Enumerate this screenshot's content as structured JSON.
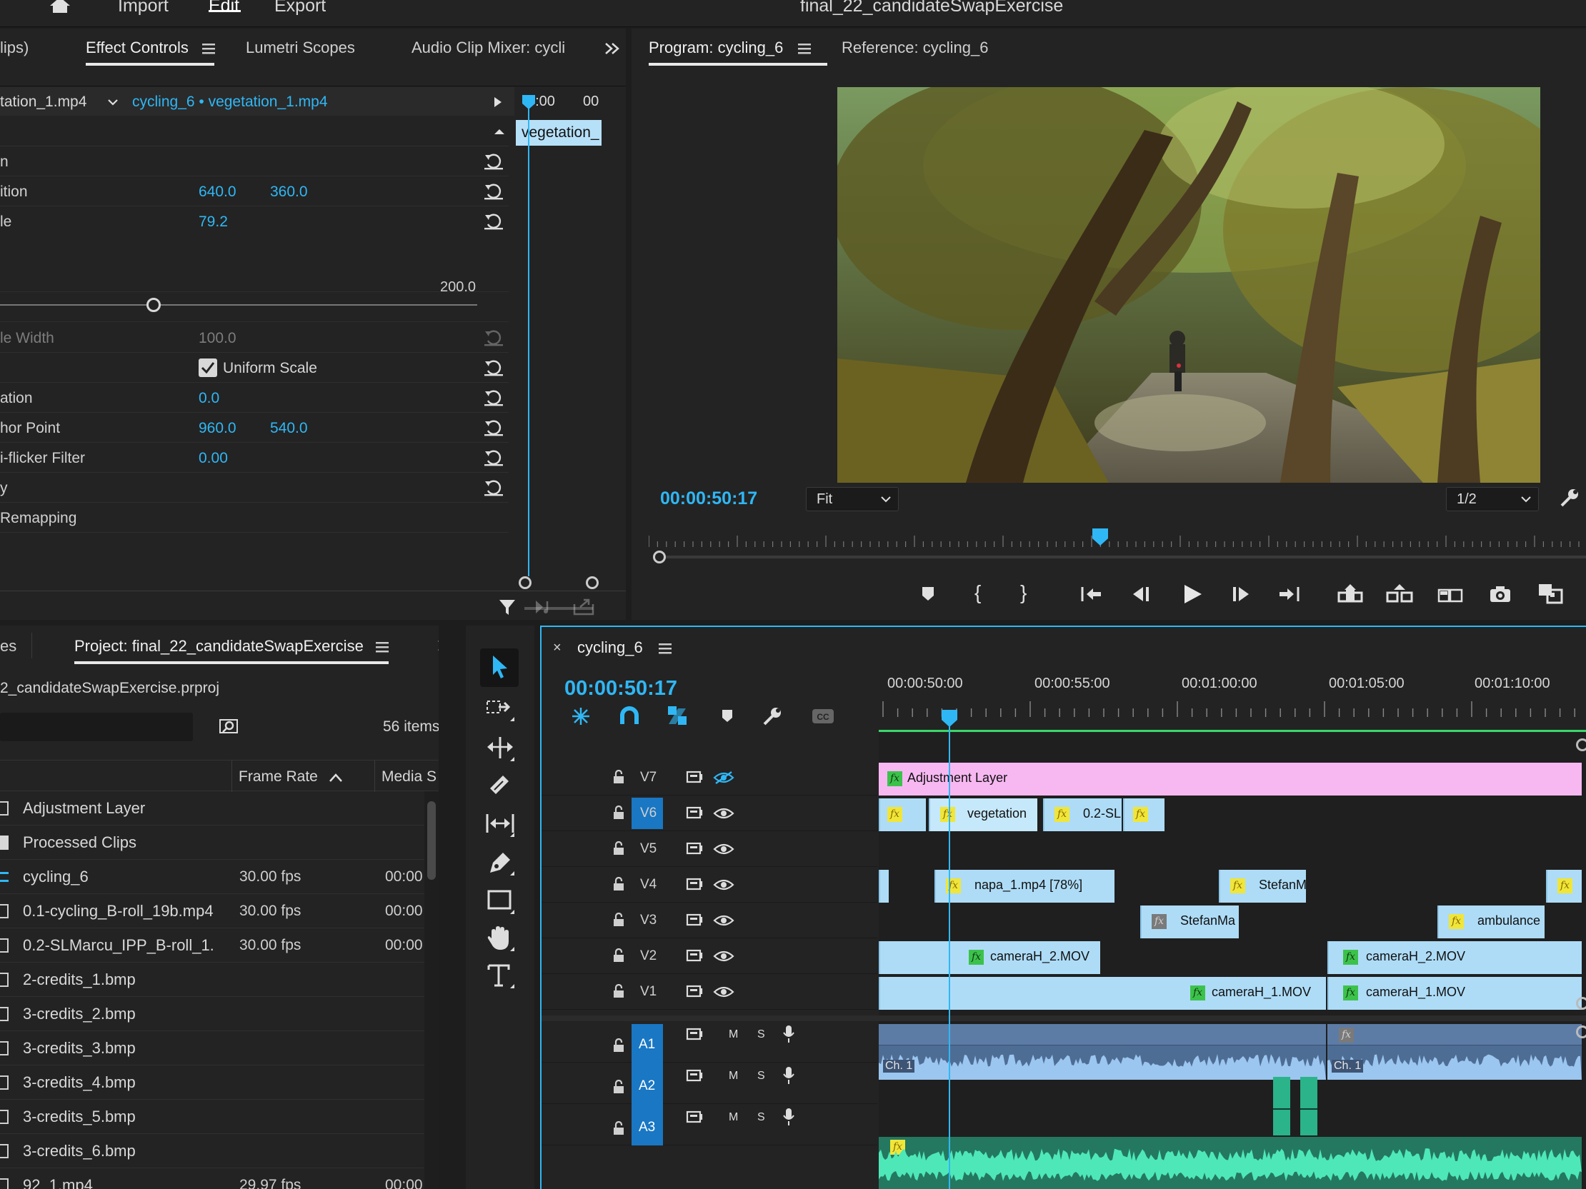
{
  "topbar": {
    "nav": [
      "Import",
      "Edit",
      "Export"
    ],
    "active_nav": "Edit",
    "doc_title": "final_22_candidateSwapExercise"
  },
  "effect_panel": {
    "tabs": [
      "lips)",
      "Effect Controls",
      "Lumetri Scopes",
      "Audio Clip Mixer: cycli"
    ],
    "source_clip": "tation_1.mp4",
    "sequence_clip": "cycling_6 • vegetation_1.mp4",
    "mini_timecodes": [
      "0:00",
      "00"
    ],
    "mini_clip": "vegetation_",
    "rows": [
      {
        "label": "n",
        "v1": "",
        "v2": ""
      },
      {
        "label": "ition",
        "v1": "640.0",
        "v2": "360.0"
      },
      {
        "label": "le",
        "v1": "79.2",
        "v2": ""
      },
      {
        "label": "le Width",
        "v1": "100.0",
        "v2": ""
      },
      {
        "label": "",
        "v1": "Uniform Scale",
        "v2": ""
      },
      {
        "label": "ation",
        "v1": "0.0",
        "v2": ""
      },
      {
        "label": "hor Point",
        "v1": "960.0",
        "v2": "540.0"
      },
      {
        "label": "i-flicker Filter",
        "v1": "0.00",
        "v2": ""
      },
      {
        "label": "y",
        "v1": "",
        "v2": ""
      },
      {
        "label": "Remapping",
        "v1": "",
        "v2": ""
      }
    ],
    "slider_max": "200.0",
    "scale_slider_value": 79.2
  },
  "program": {
    "tabs": [
      "Program: cycling_6",
      "Reference: cycling_6"
    ],
    "timecode": "00:00:50:17",
    "fit": "Fit",
    "resolution": "1/2"
  },
  "project": {
    "tabs": [
      "es",
      "Project: final_22_candidateSwapExercise"
    ],
    "file": "2_candidateSwapExercise.prproj",
    "items_count": "56 items",
    "columns": [
      "Frame Rate",
      "Media S"
    ],
    "rows": [
      {
        "name": "Adjustment Layer",
        "fr": "",
        "ms": ""
      },
      {
        "name": "Processed Clips",
        "fr": "",
        "ms": ""
      },
      {
        "name": "cycling_6",
        "fr": "30.00 fps",
        "ms": "00:00"
      },
      {
        "name": "0.1-cycling_B-roll_19b.mp4",
        "fr": "30.00 fps",
        "ms": "00:00"
      },
      {
        "name": "0.2-SLMarcu_IPP_B-roll_1.",
        "fr": "30.00 fps",
        "ms": "00:00"
      },
      {
        "name": "2-credits_1.bmp",
        "fr": "",
        "ms": ""
      },
      {
        "name": "3-credits_2.bmp",
        "fr": "",
        "ms": ""
      },
      {
        "name": "3-credits_3.bmp",
        "fr": "",
        "ms": ""
      },
      {
        "name": "3-credits_4.bmp",
        "fr": "",
        "ms": ""
      },
      {
        "name": "3-credits_5.bmp",
        "fr": "",
        "ms": ""
      },
      {
        "name": "3-credits_6.bmp",
        "fr": "",
        "ms": ""
      },
      {
        "name": "92_1.mp4",
        "fr": "29.97 fps",
        "ms": "00:00"
      }
    ]
  },
  "timeline": {
    "sequence": "cycling_6",
    "timecode": "00:00:50:17",
    "ruler": [
      "00:00:50:00",
      "00:00:55:00",
      "00:01:00:00",
      "00:01:05:00",
      "00:01:10:00"
    ],
    "tracks": {
      "v7": "V7",
      "v6": "V6",
      "v5": "V5",
      "v4": "V4",
      "v3": "V3",
      "v2": "V2",
      "v1": "V1",
      "a1": "A1",
      "a2": "A2",
      "a3": "A3"
    },
    "audio_btn": {
      "m": "M",
      "s": "S"
    },
    "clips": {
      "adj": "Adjustment Layer",
      "veg": "vegetation",
      "sl": "0.2-SL",
      "napa": "napa_1.mp4 [78%]",
      "stefan1": "StefanMarcu",
      "stefan2": "StefanMa",
      "ambulance": "ambulance",
      "camH2a": "cameraH_2.MOV",
      "camH2b": "cameraH_2.MOV",
      "camH1a": "cameraH_1.MOV",
      "camH1b": "cameraH_1.MOV",
      "ch1a": "Ch. 1",
      "ch1b": "Ch. 1",
      "cc": "CC"
    }
  },
  "icons": [
    "home-icon",
    "panel-menu-icon",
    "expand-panels-icon",
    "reset-icon",
    "filter-icon",
    "wrench-icon",
    "play-icon",
    "camera-icon",
    "selection-tool-icon",
    "type-tool-icon",
    "hand-tool-icon",
    "eye-icon",
    "lock-icon",
    "mic-icon"
  ],
  "colors": {
    "accent": "#2fb7f5",
    "adjustment": "#f7b8f2",
    "video_clip": "#aedcf7",
    "audio_blue": "#5a7aa3",
    "audio_green": "#2bb38a"
  }
}
